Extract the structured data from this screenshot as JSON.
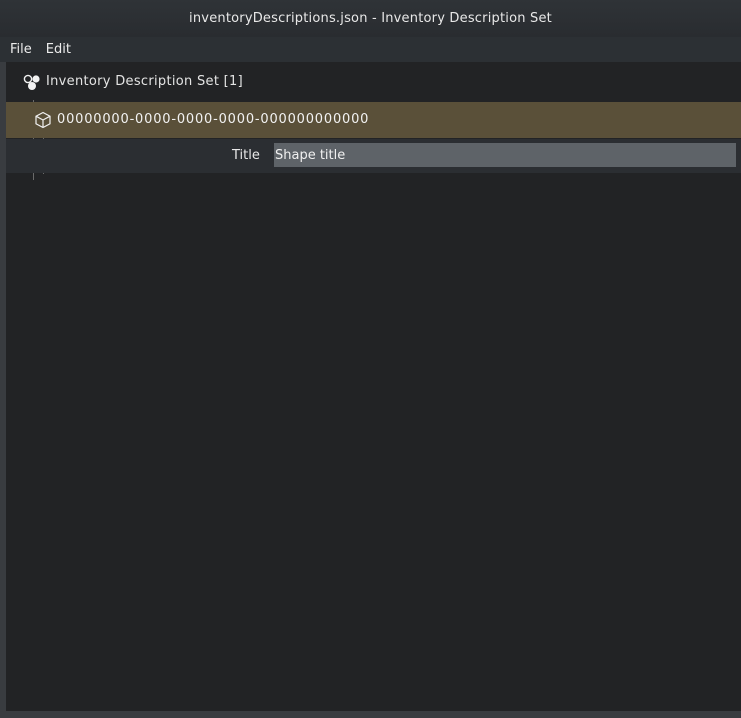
{
  "window": {
    "title": "inventoryDescriptions.json - Inventory Description Set"
  },
  "menu": {
    "items": [
      "File",
      "Edit"
    ]
  },
  "tree": {
    "root": {
      "label": "Inventory Description Set [1]",
      "icon": "components-icon"
    },
    "item": {
      "label": "00000000-0000-0000-0000-000000000000",
      "icon": "cube-icon",
      "selected": true
    },
    "field": {
      "label": "Title",
      "value": "Shape title"
    }
  },
  "colors": {
    "selected_row": "#5a5039",
    "background": "#222325",
    "input_bg": "#5e6368"
  }
}
